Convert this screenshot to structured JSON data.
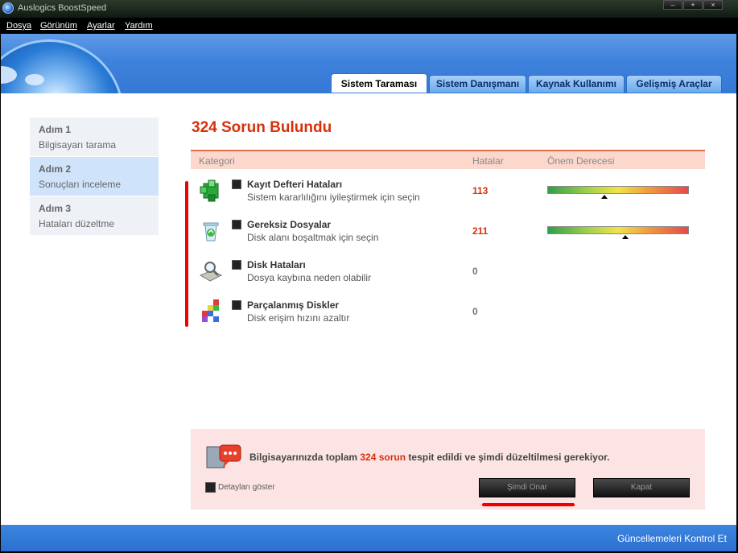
{
  "window": {
    "title": "Auslogics BoostSpeed",
    "controls": [
      "–",
      "+",
      "×"
    ]
  },
  "menu": [
    {
      "label": "Dosya"
    },
    {
      "label": "Görünüm"
    },
    {
      "label": "Ayarlar"
    },
    {
      "label": "Yardım"
    }
  ],
  "tabs": [
    {
      "label": "Sistem Taraması"
    },
    {
      "label": "Sistem Danışmanı"
    },
    {
      "label": "Kaynak Kullanımı"
    },
    {
      "label": "Gelişmiş Araçlar"
    }
  ],
  "steps": [
    {
      "title": "Adım 1",
      "subtitle": "Bilgisayarı tarama"
    },
    {
      "title": "Adım 2",
      "subtitle": "Sonuçları inceleme"
    },
    {
      "title": "Adım 3",
      "subtitle": "Hataları düzeltme"
    }
  ],
  "headline": "324 Sorun Bulundu",
  "table": {
    "headers": {
      "category": "Kategori",
      "errors": "Hatalar",
      "severity": "Önem Derecesi"
    },
    "rows": [
      {
        "icon": "registry-cube-icon",
        "title": "Kayıt Defteri Hataları",
        "subtitle": "Sistem kararlılığını iyileştirmek için seçin",
        "count": "113",
        "severity": 0.4
      },
      {
        "icon": "recycle-bin-icon",
        "title": "Gereksiz Dosyalar",
        "subtitle": "Disk alanı boşaltmak için seçin",
        "count": "211",
        "severity": 0.55
      },
      {
        "icon": "disk-magnifier-icon",
        "title": "Disk Hataları",
        "subtitle": "Dosya kaybına neden olabilir",
        "count": "0"
      },
      {
        "icon": "fragmented-blocks-icon",
        "title": "Parçalanmış Diskler",
        "subtitle": "Disk erişim hızını azaltır",
        "count": "0"
      }
    ]
  },
  "summary": {
    "prefix": "Bilgisayarınızda toplam ",
    "count": "324 sorun",
    "suffix": " tespit edildi ve şimdi düzeltilmesi gerekiyor."
  },
  "details_label": "Detayları göster",
  "buttons": {
    "repair": "Şimdi Onar",
    "cancel": "Kapat"
  },
  "status_link": "Güncellemeleri Kontrol Et",
  "colors": {
    "accent_red": "#d6300a",
    "header_blue": "#3f82dc"
  }
}
